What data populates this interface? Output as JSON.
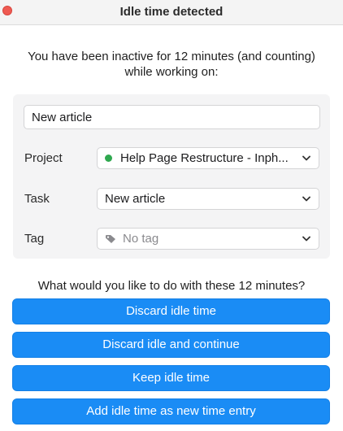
{
  "window": {
    "title": "Idle time detected"
  },
  "message": "You have been inactive for 12 minutes (and counting) while working on:",
  "form": {
    "description_value": "New article",
    "project": {
      "label": "Project",
      "value": "Help Page Restructure - Inph...",
      "dot_color": "#2fa84f"
    },
    "task": {
      "label": "Task",
      "value": "New article"
    },
    "tag": {
      "label": "Tag",
      "value": "No tag"
    }
  },
  "question": "What would you like to do with these 12 minutes?",
  "actions": {
    "discard": "Discard idle time",
    "discard_continue": "Discard idle and continue",
    "keep": "Keep idle time",
    "add_entry": "Add idle time as new time entry"
  },
  "colors": {
    "accent": "#1a8cf5",
    "close": "#ef5a52"
  },
  "icons": {
    "close": "close-dot-icon",
    "chevron": "chevron-down-icon",
    "tag": "tag-icon"
  }
}
